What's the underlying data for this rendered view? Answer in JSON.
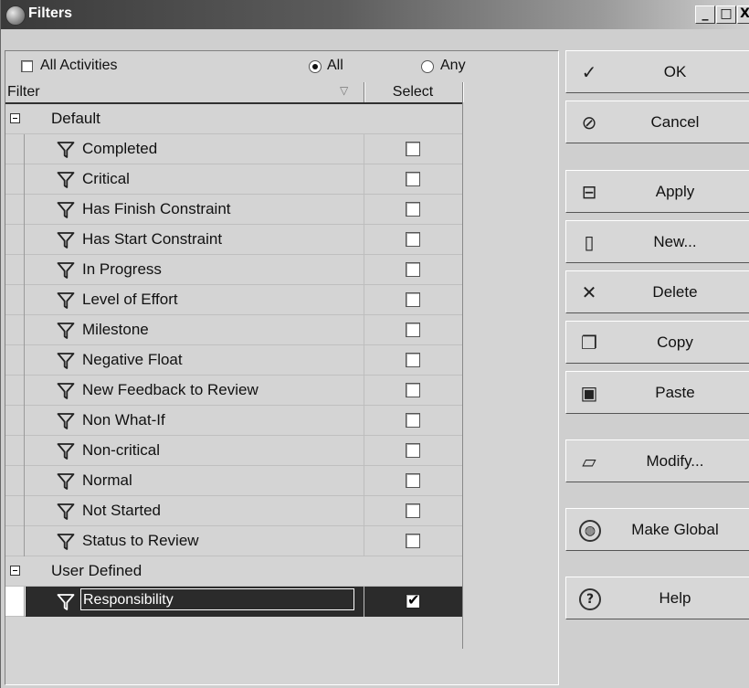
{
  "window": {
    "title": "Filters"
  },
  "titlebar_buttons": {
    "minimize": "_",
    "maximize": "□",
    "close": "X"
  },
  "options": {
    "all_activities_label": "All Activities",
    "all_activities_checked": false,
    "match_all_label": "All",
    "match_any_label": "Any",
    "match_selected": "All"
  },
  "table": {
    "columns": [
      "Filter",
      "Select"
    ],
    "groups": [
      {
        "label": "Default",
        "expanded": true,
        "items": [
          {
            "label": "Completed",
            "checked": false
          },
          {
            "label": "Critical",
            "checked": false
          },
          {
            "label": "Has Finish Constraint",
            "checked": false
          },
          {
            "label": "Has Start Constraint",
            "checked": false
          },
          {
            "label": "In Progress",
            "checked": false
          },
          {
            "label": "Level of Effort",
            "checked": false
          },
          {
            "label": "Milestone",
            "checked": false
          },
          {
            "label": "Negative Float",
            "checked": false
          },
          {
            "label": "New Feedback to Review",
            "checked": false
          },
          {
            "label": "Non What-If",
            "checked": false
          },
          {
            "label": "Non-critical",
            "checked": false
          },
          {
            "label": "Normal",
            "checked": false
          },
          {
            "label": "Not Started",
            "checked": false
          },
          {
            "label": "Status to Review",
            "checked": false
          }
        ]
      },
      {
        "label": "User Defined",
        "expanded": true,
        "items": [
          {
            "label": "Responsibility",
            "checked": true,
            "selected": true
          }
        ]
      }
    ]
  },
  "buttons": [
    {
      "label": "OK",
      "icon": "checkmark-icon"
    },
    {
      "label": "Cancel",
      "icon": "cancel-icon"
    },
    {
      "label": "Apply",
      "icon": "apply-icon"
    },
    {
      "label": "New...",
      "icon": "new-document-icon"
    },
    {
      "label": "Delete",
      "icon": "delete-icon"
    },
    {
      "label": "Copy",
      "icon": "copy-icon"
    },
    {
      "label": "Paste",
      "icon": "paste-icon"
    },
    {
      "label": "Modify...",
      "icon": "modify-icon"
    },
    {
      "label": "Make Global",
      "icon": "globe-icon"
    },
    {
      "label": "Help",
      "icon": "help-icon"
    }
  ]
}
